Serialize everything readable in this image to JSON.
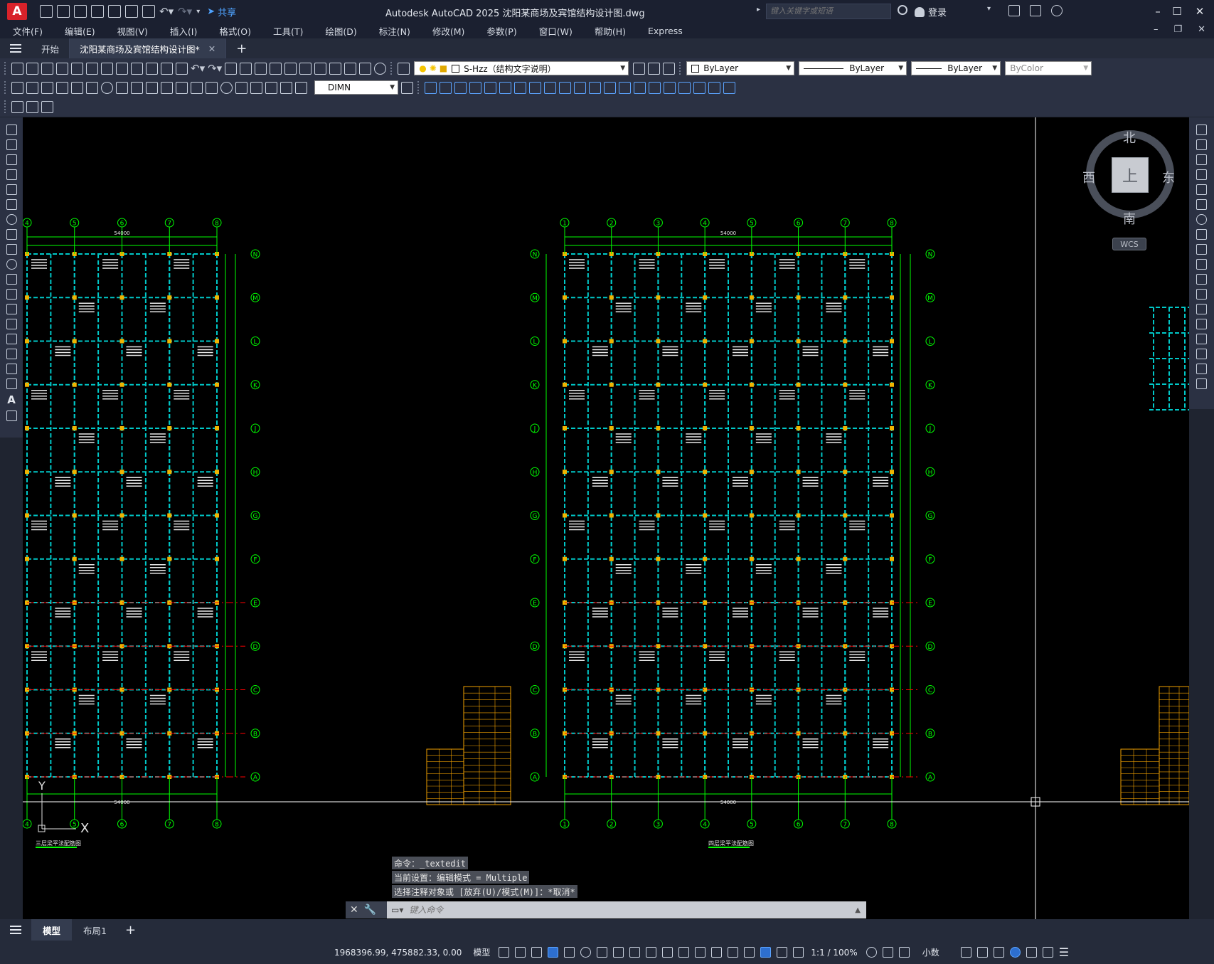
{
  "titlebar": {
    "app_logo": "A",
    "share": "共享",
    "title": "Autodesk AutoCAD 2025    沈阳某商场及宾馆结构设计图.dwg",
    "search_placeholder": "键入关键字或短语",
    "login": "登录",
    "minimize": "–",
    "maximize": "☐",
    "close": "✕"
  },
  "menubar": {
    "items": [
      "文件(F)",
      "编辑(E)",
      "视图(V)",
      "插入(I)",
      "格式(O)",
      "工具(T)",
      "绘图(D)",
      "标注(N)",
      "修改(M)",
      "参数(P)",
      "窗口(W)",
      "帮助(H)",
      "Express"
    ],
    "doc_minimize": "–",
    "doc_restore": "❐",
    "doc_close": "✕"
  },
  "tabs": {
    "start": "开始",
    "active_doc": "沈阳某商场及宾馆结构设计图*",
    "close": "✕",
    "new": "+"
  },
  "toolbar": {
    "layer_combo": "S-Hzz（结构文字说明）",
    "color_combo": "ByLayer",
    "linetype_combo": "ByLayer",
    "lineweight_combo": "ByLayer",
    "plotstyle_combo": "ByColor",
    "dimstyle_combo": "DIMN"
  },
  "viewcube": {
    "north": "北",
    "south": "南",
    "east": "东",
    "west": "西",
    "face": "上",
    "wcs": "WCS"
  },
  "drawing": {
    "grid_top_left": [
      "4",
      "5",
      "6",
      "7",
      "8"
    ],
    "grid_top_mid": [
      "1",
      "2",
      "3",
      "4",
      "5",
      "6",
      "7",
      "8"
    ],
    "grid_rows": [
      "N",
      "M",
      "L",
      "K",
      "J",
      "H",
      "G",
      "F",
      "E",
      "D",
      "C",
      "B",
      "A"
    ],
    "total_dim": "54000",
    "plan_left_title": "三层梁平法配筋图",
    "plan_mid_title": "四层梁平法配筋图",
    "ucs_x": "X",
    "ucs_y": "Y"
  },
  "command": {
    "history": [
      "命令：_textedit",
      "当前设置：编辑模式 = Multiple",
      "选择注释对象或 [放弃(U)/模式(M)]：*取消*"
    ],
    "prompt": "键入命令"
  },
  "layout": {
    "model": "模型",
    "layout1": "布局1",
    "add": "+"
  },
  "status": {
    "coords": "1968396.99, 475882.33, 0.00",
    "space": "模型",
    "scale": "1:1 / 100%",
    "units": "小数"
  },
  "colors": {
    "canvas": "#000000",
    "grid_green": "#00ff00",
    "beam_cyan": "#00c8c8",
    "axis_red": "#ff0000",
    "accent_blue": "#2d6fcf"
  }
}
